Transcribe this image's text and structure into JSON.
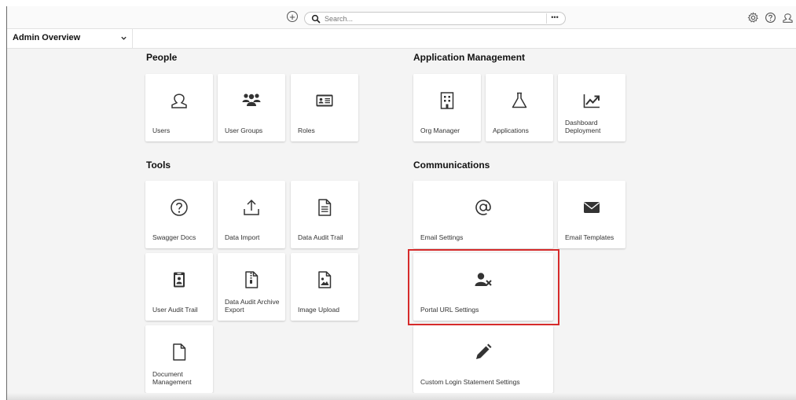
{
  "topbar": {
    "search_placeholder": "Search...",
    "more_label": "•••"
  },
  "overview": {
    "label": "Admin Overview"
  },
  "sections": {
    "people": {
      "title": "People",
      "tiles": [
        {
          "label": "Users",
          "icon": "user-icon"
        },
        {
          "label": "User Groups",
          "icon": "user-group-icon"
        },
        {
          "label": "Roles",
          "icon": "id-card-icon"
        }
      ]
    },
    "appmgmt": {
      "title": "Application Management",
      "tiles": [
        {
          "label": "Org Manager",
          "icon": "building-icon"
        },
        {
          "label": "Applications",
          "icon": "flask-icon"
        },
        {
          "label": "Dashboard Deployment",
          "icon": "chart-line-icon"
        }
      ]
    },
    "tools": {
      "title": "Tools",
      "tiles": [
        {
          "label": "Swagger Docs",
          "icon": "question-circle-icon"
        },
        {
          "label": "Data Import",
          "icon": "upload-icon"
        },
        {
          "label": "Data Audit Trail",
          "icon": "document-icon"
        },
        {
          "label": "User Audit Trail",
          "icon": "badge-icon"
        },
        {
          "label": "Data Audit Archive Export",
          "icon": "zip-file-icon"
        },
        {
          "label": "Image Upload",
          "icon": "image-file-icon"
        },
        {
          "label": "Document Management",
          "icon": "blank-file-icon"
        }
      ]
    },
    "comms": {
      "title": "Communications",
      "tiles": [
        {
          "label": "Email Settings",
          "icon": "at-sign-icon"
        },
        {
          "label": "Email Templates",
          "icon": "envelope-icon"
        },
        {
          "label": "Portal URL Settings",
          "icon": "user-remove-icon"
        },
        {
          "label": "Custom Login Statement Settings",
          "icon": "pen-icon"
        }
      ]
    }
  },
  "colors": {
    "background": "#f4f4f4",
    "tile": "#ffffff",
    "highlight": "#d62b2b",
    "text": "#333333"
  }
}
